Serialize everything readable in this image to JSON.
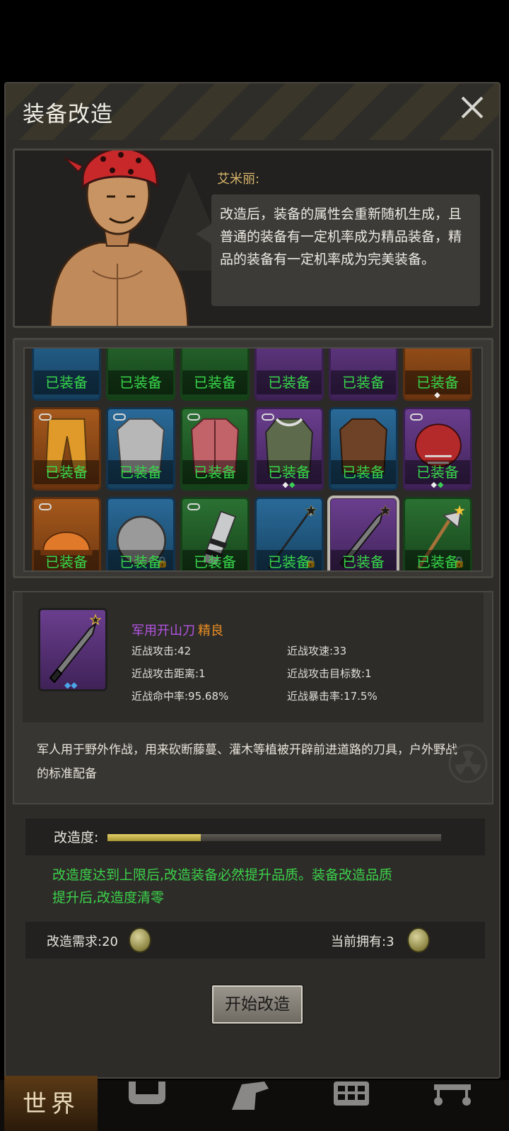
{
  "dialog": {
    "title": "装备改造",
    "close_icon": "close-icon"
  },
  "npc": {
    "name": "艾米丽:",
    "speech": "改造后，装备的属性会重新随机生成，且普通的装备有一定机率成为精品装备，精品的装备有一定机率成为完美装备。"
  },
  "inventory": {
    "equipped_label": "已装备",
    "slots": [
      {
        "color": "blue",
        "icon": "item-partial-icon",
        "badges": []
      },
      {
        "color": "green",
        "icon": "item-partial-icon",
        "badges": []
      },
      {
        "color": "green",
        "icon": "item-partial-icon",
        "badges": []
      },
      {
        "color": "purple",
        "icon": "item-partial-icon",
        "badges": []
      },
      {
        "color": "purple",
        "icon": "item-partial-icon",
        "badges": []
      },
      {
        "color": "orange",
        "icon": "item-partial-icon",
        "badges": []
      },
      {
        "color": "orange",
        "icon": "pants-icon",
        "badges": [
          "link"
        ]
      },
      {
        "color": "blue",
        "icon": "shirt-icon",
        "badges": [
          "link"
        ]
      },
      {
        "color": "green",
        "icon": "jacket-icon",
        "badges": [
          "link"
        ]
      },
      {
        "color": "purple",
        "icon": "parka-icon",
        "badges": [
          "link"
        ]
      },
      {
        "color": "blue",
        "icon": "leather-jacket-icon",
        "badges": []
      },
      {
        "color": "purple",
        "icon": "football-helmet-icon",
        "badges": [
          "link"
        ]
      },
      {
        "color": "orange",
        "icon": "hard-hat-icon",
        "badges": [
          "link"
        ]
      },
      {
        "color": "blue",
        "icon": "round-shield-icon",
        "badges": [
          "lock"
        ]
      },
      {
        "color": "green",
        "icon": "arm-guard-icon",
        "badges": [
          "link"
        ]
      },
      {
        "color": "blue",
        "icon": "spear-icon",
        "badges": [
          "star",
          "lock"
        ]
      },
      {
        "color": "purple",
        "icon": "machete-icon",
        "badges": [
          "star"
        ],
        "selected": true
      },
      {
        "color": "green",
        "icon": "axe-icon",
        "badges": [
          "star-filled",
          "lock"
        ]
      }
    ]
  },
  "item": {
    "name": "军用开山刀",
    "quality": "精良",
    "icon": "machete-icon",
    "stats": [
      {
        "label": "近战攻击:42"
      },
      {
        "label": "近战攻速:33"
      },
      {
        "label": "近战攻击距离:1"
      },
      {
        "label": "近战攻击目标数:1"
      },
      {
        "label": "近战命中率:95.68%"
      },
      {
        "label": "近战暴击率:17.5%"
      }
    ],
    "description": "军人用于野外作战，用来砍断藤蔓、灌木等植被开辟前进道路的刀具，户外野战的标准配备"
  },
  "modify": {
    "progress_label": "改造度:",
    "progress_fraction": 0.28,
    "hint": "改造度达到上限后,改造装备必然提升品质。装备改造品质提升后,改造度清零",
    "cost_label": "改造需求:20",
    "owned_label": "当前拥有:3",
    "coin_icon": "bottle-cap-coin-icon",
    "start_button": "开始改造"
  },
  "nav": {
    "world_label": "世界",
    "items": [
      "bag-icon",
      "hand-icon",
      "grid-icon",
      "cart-icon"
    ]
  },
  "colors": {
    "equipped_text": "#37d54a",
    "hint_text": "#3cd24a",
    "rare_name": "#b454e2",
    "quality_text": "#e88c22"
  }
}
